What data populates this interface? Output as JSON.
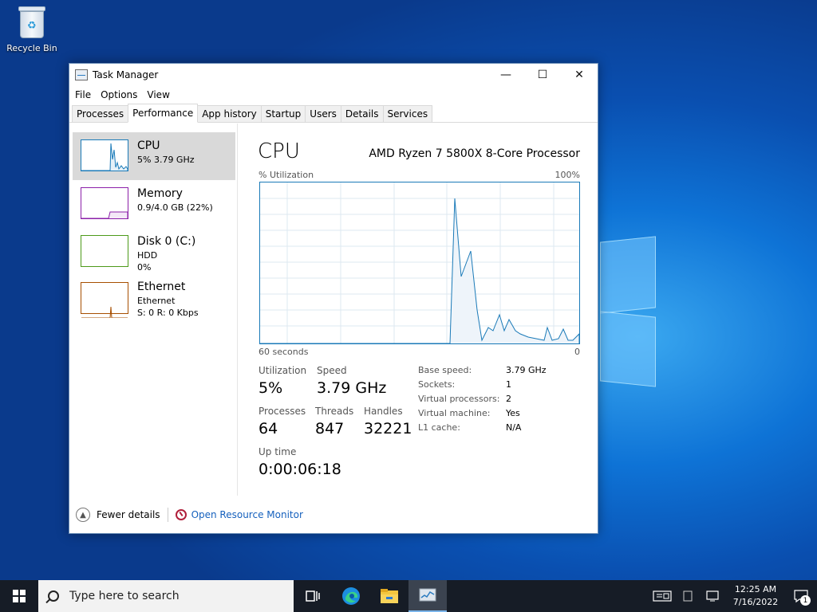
{
  "desktop": {
    "recycle_bin_label": "Recycle Bin"
  },
  "window": {
    "title": "Task Manager",
    "minimize": "—",
    "maximize": "☐",
    "close": "✕"
  },
  "menu": [
    "File",
    "Options",
    "View"
  ],
  "tabs": [
    "Processes",
    "Performance",
    "App history",
    "Startup",
    "Users",
    "Details",
    "Services"
  ],
  "active_tab": "Performance",
  "sidebar": {
    "items": [
      {
        "name": "CPU",
        "lines": [
          "5%  3.79 GHz"
        ],
        "color": "#1a7ab8"
      },
      {
        "name": "Memory",
        "lines": [
          "0.9/4.0 GB (22%)"
        ],
        "color": "#8b1fa8"
      },
      {
        "name": "Disk 0 (C:)",
        "lines": [
          "HDD",
          "0%"
        ],
        "color": "#4d9a19"
      },
      {
        "name": "Ethernet",
        "lines": [
          "Ethernet",
          "S: 0  R: 0 Kbps"
        ],
        "color": "#a74f01"
      }
    ]
  },
  "main": {
    "title": "CPU",
    "model": "AMD Ryzen 7 5800X 8-Core Processor",
    "util_label": "% Utilization",
    "util_max": "100%",
    "graph_left": "60 seconds",
    "graph_right": "0",
    "utilization_label": "Utilization",
    "utilization": "5%",
    "speed_label": "Speed",
    "speed": "3.79 GHz",
    "processes_label": "Processes",
    "processes": "64",
    "threads_label": "Threads",
    "threads": "847",
    "handles_label": "Handles",
    "handles": "32221",
    "uptime_label": "Up time",
    "uptime": "0:00:06:18",
    "info": [
      {
        "k": "Base speed:",
        "v": "3.79 GHz"
      },
      {
        "k": "Sockets:",
        "v": "1"
      },
      {
        "k": "Virtual processors:",
        "v": "2"
      },
      {
        "k": "Virtual machine:",
        "v": "Yes"
      },
      {
        "k": "L1 cache:",
        "v": "N/A"
      }
    ]
  },
  "footer": {
    "fewer_details": "Fewer details",
    "open_resource_monitor": "Open Resource Monitor"
  },
  "taskbar": {
    "search_placeholder": "Type here to search",
    "time": "12:25 AM",
    "date": "7/16/2022",
    "notification_count": "1"
  }
}
